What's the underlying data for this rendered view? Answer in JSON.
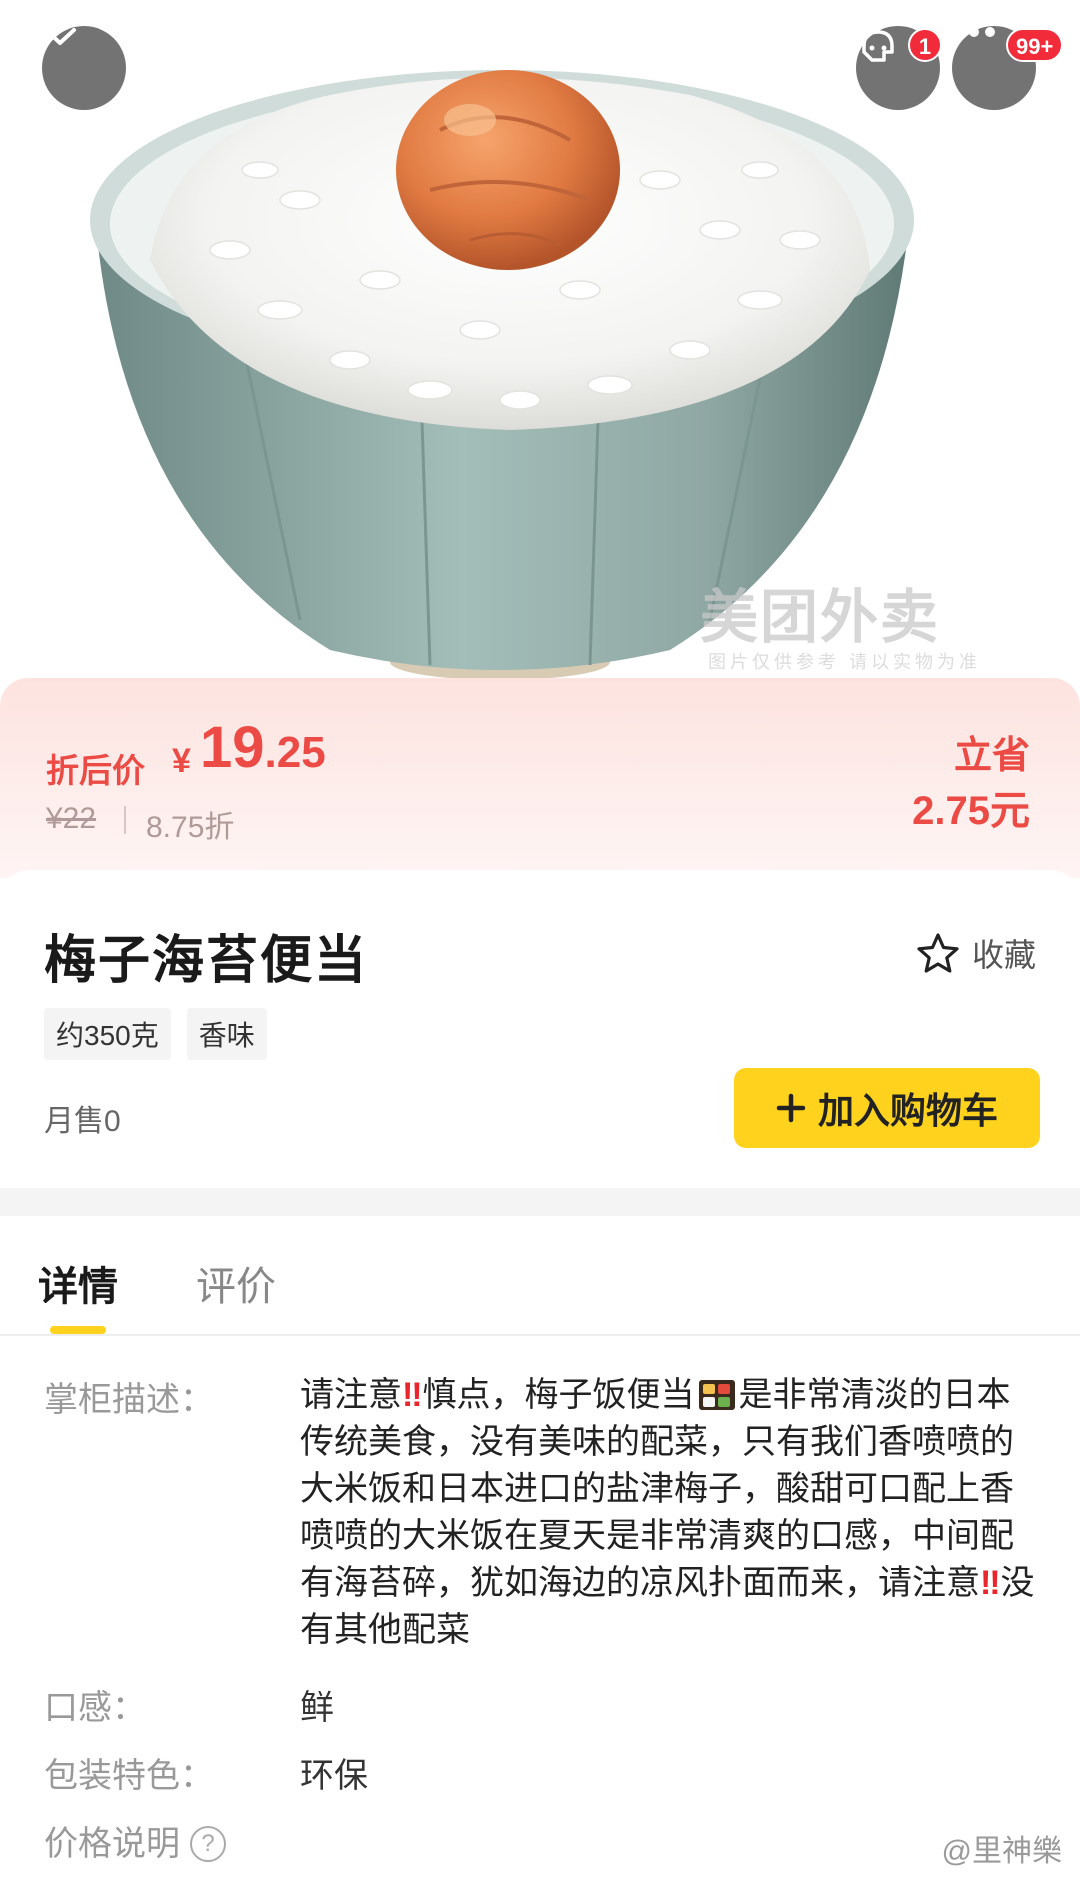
{
  "header": {
    "cs_badge": "1",
    "more_badge": "99+"
  },
  "image": {
    "watermark": "美团外卖",
    "watermark_sub": "图片仅供参考 请以实物为准"
  },
  "price": {
    "discount_label": "折后价",
    "currency": "¥",
    "price_int": "19",
    "price_dec": ".25",
    "original": "¥22",
    "discount_rate": "8.75折",
    "save_label": "立省",
    "save_amount": "2.75元"
  },
  "product": {
    "title": "梅子海苔便当",
    "favorite_label": "收藏",
    "tags": [
      "约350克",
      "香味"
    ],
    "monthly_sales": "月售0",
    "add_to_cart": "加入购物车"
  },
  "tabs": {
    "details": "详情",
    "reviews": "评价"
  },
  "details": {
    "desc_label": "掌柜描述：",
    "desc_part1": "请注意",
    "desc_part2": "慎点，梅子饭便当",
    "desc_part3": "是非常清淡的日本传统美食，没有美味的配菜，只有我们香喷喷的大米饭和日本进口的盐津梅子，酸甜可口配上香喷喷的大米饭在夏天是非常清爽的口感，中间配有海苔碎，犹如海边的凉风扑面而来，请注意",
    "desc_part4": "没有其他配菜",
    "bang": "‼",
    "taste_label": "口感：",
    "taste_value": "鲜",
    "package_label": "包装特色：",
    "package_value": "环保",
    "price_note_label": "价格说明",
    "help_glyph": "?"
  },
  "footer": {
    "weibo_mark": "@里神樂"
  },
  "colors": {
    "accent_red": "#ec4a44",
    "cart_yellow": "#ffd31d"
  }
}
